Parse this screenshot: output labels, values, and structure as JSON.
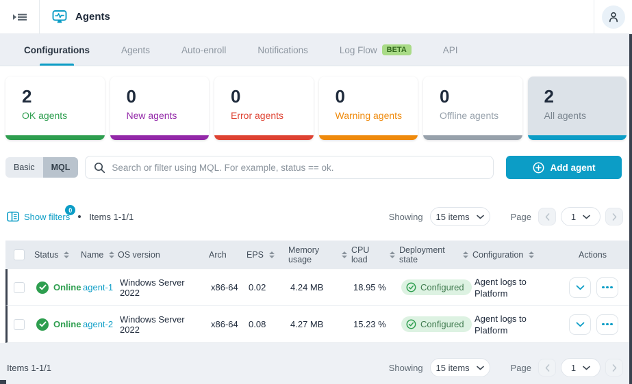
{
  "header": {
    "title": "Agents"
  },
  "tabs": [
    {
      "label": "Configurations",
      "active": true
    },
    {
      "label": "Agents",
      "active": false
    },
    {
      "label": "Auto-enroll",
      "active": false
    },
    {
      "label": "Notifications",
      "active": false
    },
    {
      "label": "Log Flow",
      "badge": "BETA",
      "active": false
    },
    {
      "label": "API",
      "active": false
    }
  ],
  "cards": [
    {
      "value": "2",
      "label": "OK agents",
      "color": "#2e9e4f",
      "selected": false
    },
    {
      "value": "0",
      "label": "New agents",
      "color": "#9328a8",
      "selected": false
    },
    {
      "value": "0",
      "label": "Error agents",
      "color": "#de4232",
      "selected": false
    },
    {
      "value": "0",
      "label": "Warning agents",
      "color": "#ef8a0c",
      "selected": false
    },
    {
      "value": "0",
      "label": "Offline agents",
      "color": "#97a1ab",
      "selected": false
    },
    {
      "value": "2",
      "label": "All agents",
      "color": "#0c9dc6",
      "selected": true
    }
  ],
  "toolbar": {
    "mode_basic": "Basic",
    "mode_mql": "MQL",
    "search_placeholder": "Search or filter using MQL. For example, status == ok.",
    "add_agent": "Add agent"
  },
  "filters": {
    "show_filters": "Show filters",
    "badge": "0",
    "items": "Items 1-1/1"
  },
  "pagination": {
    "showing_label": "Showing",
    "items_option": "15 items",
    "page_label": "Page",
    "page": "1"
  },
  "table": {
    "columns": [
      {
        "label": "Status"
      },
      {
        "label": "Name"
      },
      {
        "label": "OS version"
      },
      {
        "label": "Arch"
      },
      {
        "label": "EPS"
      },
      {
        "label": "Memory usage"
      },
      {
        "label": "CPU load"
      },
      {
        "label": "Deployment state"
      },
      {
        "label": "Configuration"
      },
      {
        "label": "Actions"
      }
    ],
    "rows": [
      {
        "status": "Online",
        "name": "agent-1",
        "os": "Windows Server 2022",
        "arch": "x86-64",
        "eps": "0.02",
        "memory": "4.24 MB",
        "cpu": "18.95 %",
        "deployment": "Configured",
        "configuration": "Agent logs to Platform"
      },
      {
        "status": "Online",
        "name": "agent-2",
        "os": "Windows Server 2022",
        "arch": "x86-64",
        "eps": "0.08",
        "memory": "4.27 MB",
        "cpu": "15.23 %",
        "deployment": "Configured",
        "configuration": "Agent logs to Platform"
      }
    ]
  },
  "footer": {
    "items": "Items 1-1/1"
  },
  "colors": {
    "accent_teal": "#0c9dc6",
    "ok_green": "#2e9e4f",
    "new_purple": "#9328a8",
    "error_red": "#de4232",
    "warning_orange": "#ef8a0c",
    "offline_gray": "#97a1ab",
    "text_navy": "#212c3d",
    "beta_badge_bg": "#a9db87"
  },
  "icons": {
    "menu": "sidebar-expand",
    "title": "monitor-pulse",
    "profile": "person",
    "search": "magnifier",
    "filter": "filter-panel",
    "add": "plus-circle",
    "status_ok": "check-circle",
    "sort": "sort-arrows",
    "chevron_down": "chevron-down",
    "ellipsis": "three-dots",
    "prev": "chevron-left",
    "next": "chevron-right"
  }
}
